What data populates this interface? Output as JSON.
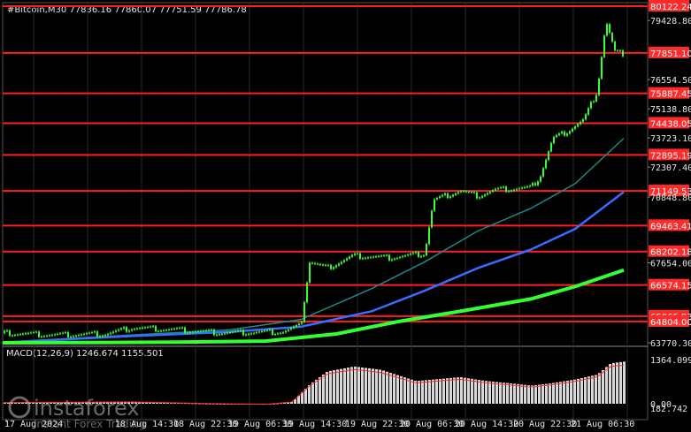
{
  "header": {
    "title": "#Bitcoin,M30  77836.16 77860.07 77751.59 77786.78",
    "macd_label": "MACD(12,26,9) 1246.674 1155.501"
  },
  "price_axis": {
    "labels": [
      "80122.24",
      "79428.80",
      "77851.10",
      "76554.50",
      "75887.45",
      "75138.80",
      "74438.05",
      "73723.10",
      "72895.19",
      "72307.40",
      "71149.53",
      "70848.80",
      "69463.41",
      "68202.18",
      "67654.00",
      "66574.15",
      "65065.83",
      "64804.00",
      "63770.30"
    ]
  },
  "macd_axis": {
    "labels": [
      "1364.099",
      "0.00",
      "182.742"
    ]
  },
  "time_axis": {
    "labels": [
      "17 Aug 2024",
      "18 Aug 14:30",
      "18 Aug 22:30",
      "19 Aug 06:30",
      "19 Aug 14:30",
      "19 Aug 22:30",
      "20 Aug 06:30",
      "20 Aug 14:30",
      "20 Aug 22:30",
      "21 Aug 06:30"
    ]
  },
  "levels": {
    "prices": [
      80122.24,
      77851.1,
      75887.45,
      74438.05,
      72895.19,
      71149.53,
      69463.41,
      68202.18,
      66574.15,
      65065.83,
      64804.0
    ],
    "color": "#ff1f1f"
  },
  "indicators": {
    "ma_fast_color": "#1a8a8a",
    "ma_mid_color": "#3b6cff",
    "ma_slow_color": "#33ff33",
    "candle_color": "#33ff33",
    "macd_bar_color": "#d9d9d9",
    "macd_signal_color": "#ff2a2a"
  },
  "watermark": {
    "brand": "instaforex",
    "tagline": "Instant Forex Trading"
  }
}
